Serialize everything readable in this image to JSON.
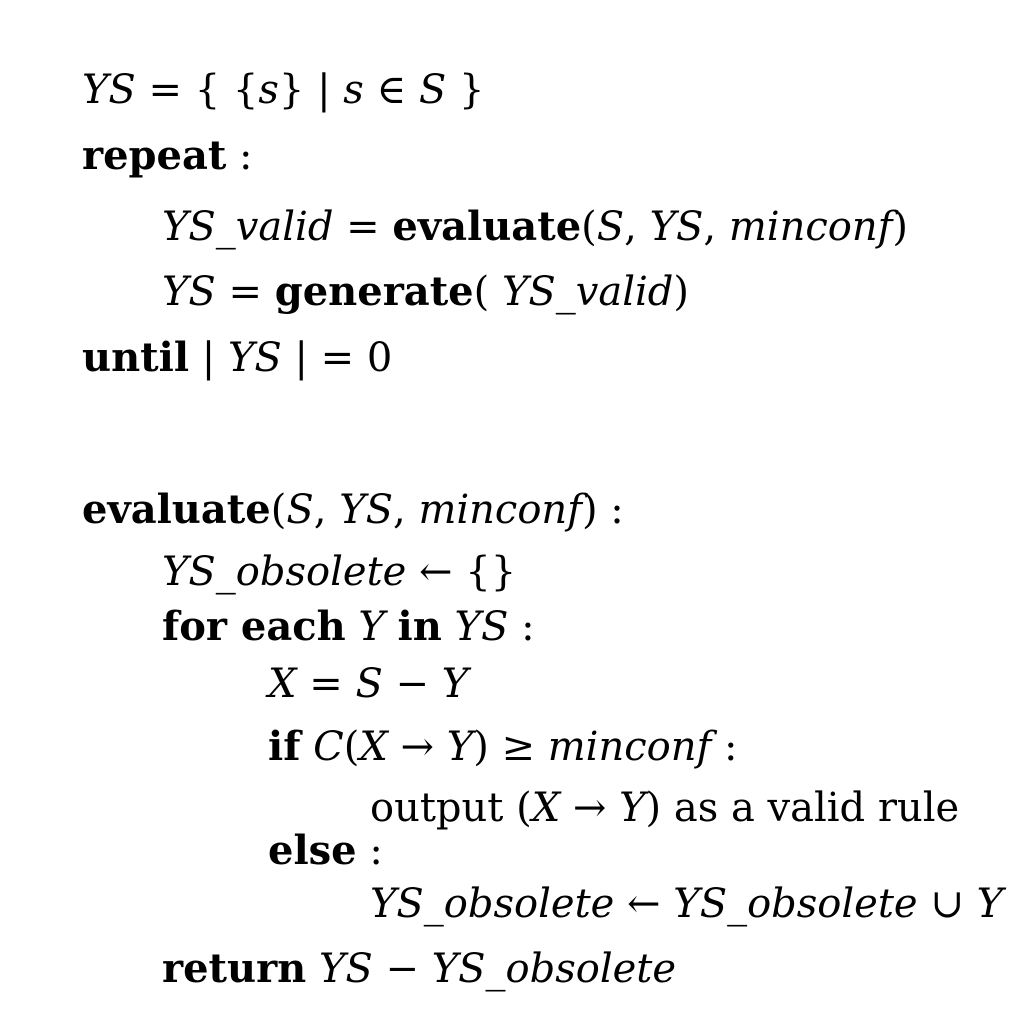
{
  "algorithm": {
    "main": {
      "line1": {
        "ys": "YS",
        "eq": " = { {",
        "s1": "s",
        "mid": "} | ",
        "s2": "s",
        "in": " ∈ ",
        "S": "S",
        "close": " }"
      },
      "repeat_kw": "repeat",
      "repeat_colon": " :",
      "line3": {
        "ysvalid": "YS_valid",
        "eq": " = ",
        "fn": "evaluate",
        "open": "(",
        "S": "S",
        "c1": ", ",
        "YS": "YS",
        "c2": ", ",
        "minconf": "minconf",
        "close": ")"
      },
      "line4": {
        "ys": "YS",
        "eq": " = ",
        "fn": "generate",
        "open": "( ",
        "ysvalid": "YS_valid",
        "close": ")"
      },
      "until": {
        "kw": "until",
        "bar1": " | ",
        "ys": "YS",
        "rest": " | = 0"
      }
    },
    "evaluate": {
      "header": {
        "fn": "evaluate",
        "open": "(",
        "S": "S",
        "c1": ", ",
        "YS": "YS",
        "c2": ", ",
        "minconf": "minconf",
        "close": ") :"
      },
      "init": {
        "obs": "YS_obsolete",
        "rest": " ← {}"
      },
      "foreach": {
        "kw1": "for each",
        "sp1": " ",
        "Y": "Y",
        "sp2": " ",
        "kw2": "in",
        "sp3": " ",
        "YS": "YS",
        "colon": " :"
      },
      "assign": {
        "X": "X",
        "eq": " = ",
        "S": "S",
        "minus": " − ",
        "Y": "Y"
      },
      "if": {
        "kw": "if",
        "sp": " ",
        "C": "C",
        "open": "(",
        "X": "X",
        "arrow": " → ",
        "Y": "Y",
        "close": ") ≥ ",
        "minconf": "minconf",
        "colon": " :"
      },
      "output": {
        "pre": "output (",
        "X": "X",
        "arrow": " → ",
        "Y": "Y",
        "post": ") as a valid rule"
      },
      "else": {
        "kw": "else",
        "colon": " :"
      },
      "union": {
        "obs1": "YS_obsolete",
        "arrow": " ← ",
        "obs2": "YS_obsolete",
        "cup": " ∪ ",
        "Y": "Y"
      },
      "return": {
        "kw": "return",
        "sp": " ",
        "YS": "YS",
        "minus": " − ",
        "obs": "YS_obsolete"
      }
    }
  }
}
